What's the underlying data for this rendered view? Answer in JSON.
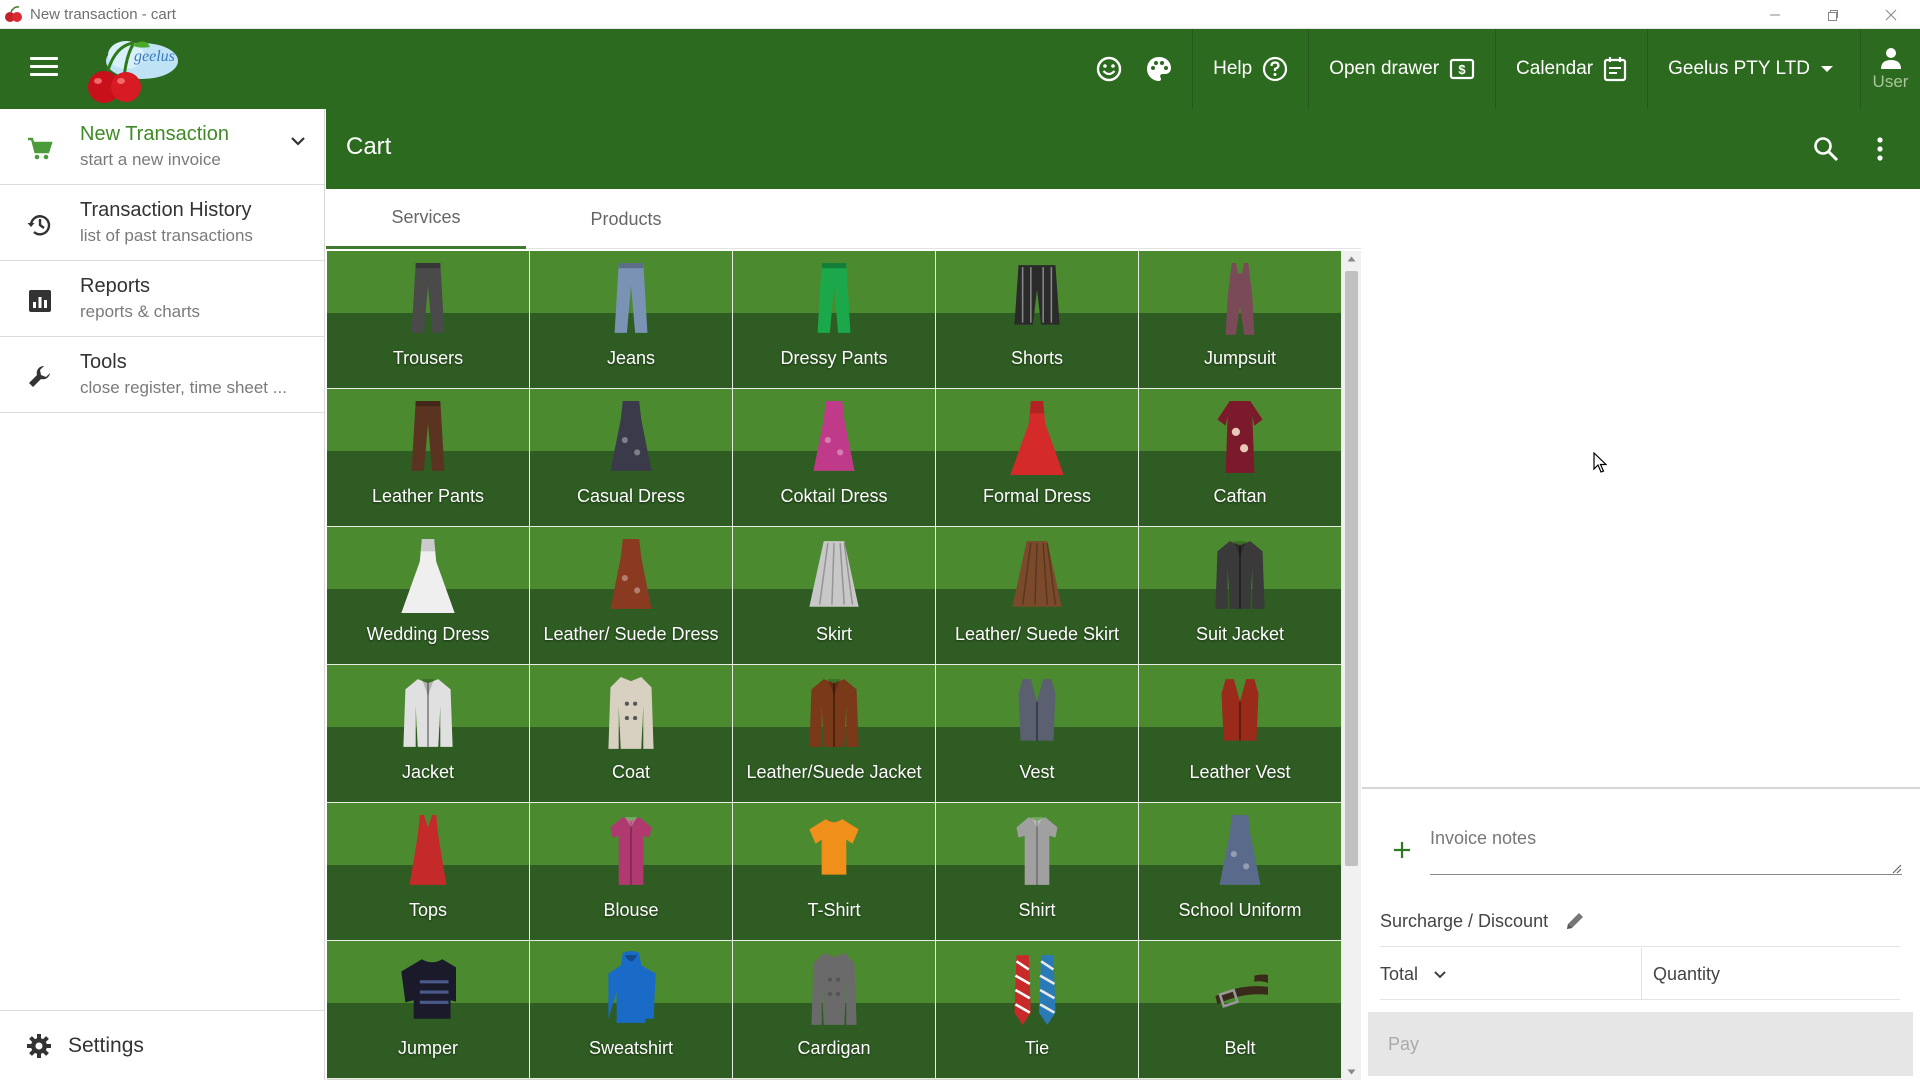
{
  "window": {
    "title": "New transaction - cart"
  },
  "topbar": {
    "help_label": "Help",
    "open_drawer_label": "Open drawer",
    "calendar_label": "Calendar",
    "company_label": "Geelus PTY LTD",
    "user_label": "User",
    "icons": [
      "menu-icon",
      "smiley-icon",
      "palette-icon",
      "help-circle-icon",
      "cash-drawer-icon",
      "calendar-icon",
      "dropdown-arrow-icon",
      "user-icon"
    ]
  },
  "sidebar": {
    "items": [
      {
        "title": "New Transaction",
        "subtitle": "start a new invoice",
        "icon": "cart-icon",
        "active": true
      },
      {
        "title": "Transaction History",
        "subtitle": "list of past transactions",
        "icon": "history-icon"
      },
      {
        "title": "Reports",
        "subtitle": "reports & charts",
        "icon": "reports-icon"
      },
      {
        "title": "Tools",
        "subtitle": "close register, time sheet ...",
        "icon": "wrench-icon"
      }
    ],
    "settings_label": "Settings"
  },
  "cart": {
    "title": "Cart",
    "tabs": [
      {
        "label": "Services",
        "active": true
      },
      {
        "label": "Products",
        "active": false
      }
    ],
    "tiles": [
      {
        "label": "Trousers",
        "art": "trousers",
        "color": "#4a4a4a"
      },
      {
        "label": "Jeans",
        "art": "trousers",
        "color": "#7a92b4"
      },
      {
        "label": "Dressy Pants",
        "art": "trousers",
        "color": "#1aa84a"
      },
      {
        "label": "Shorts",
        "art": "shorts",
        "color": "#2a2a2a"
      },
      {
        "label": "Jumpsuit",
        "art": "jumpsuit",
        "color": "#7a4a58"
      },
      {
        "label": "Leather Pants",
        "art": "trousers",
        "color": "#5a3420"
      },
      {
        "label": "Casual Dress",
        "art": "dress",
        "color": "#3a3a4a"
      },
      {
        "label": "Coktail Dress",
        "art": "dress",
        "color": "#c03a8a"
      },
      {
        "label": "Formal Dress",
        "art": "gown",
        "color": "#d42a2a"
      },
      {
        "label": "Caftan",
        "art": "caftan",
        "color": "#7a1a2a"
      },
      {
        "label": "Wedding Dress",
        "art": "gown",
        "color": "#efefef"
      },
      {
        "label": "Leather/ Suede Dress",
        "art": "dress",
        "color": "#8a3a20"
      },
      {
        "label": "Skirt",
        "art": "skirt",
        "color": "#c8c8c8"
      },
      {
        "label": "Leather/ Suede Skirt",
        "art": "skirt",
        "color": "#7a4a2a"
      },
      {
        "label": "Suit Jacket",
        "art": "jacket",
        "color": "#3a3a3a"
      },
      {
        "label": "Jacket",
        "art": "jacket",
        "color": "#e0e0e0"
      },
      {
        "label": "Coat",
        "art": "coat",
        "color": "#d8d0c0"
      },
      {
        "label": "Leather/Suede Jacket",
        "art": "jacket",
        "color": "#7a3a1a"
      },
      {
        "label": "Vest",
        "art": "vest",
        "color": "#5a6070"
      },
      {
        "label": "Leather Vest",
        "art": "vest",
        "color": "#9a2a1a"
      },
      {
        "label": "Tops",
        "art": "top",
        "color": "#c42a2a"
      },
      {
        "label": "Blouse",
        "art": "shirt",
        "color": "#b03a70"
      },
      {
        "label": "T-Shirt",
        "art": "tshirt",
        "color": "#f0901a"
      },
      {
        "label": "Shirt",
        "art": "shirt",
        "color": "#a0a0a0"
      },
      {
        "label": "School Uniform",
        "art": "dress",
        "color": "#5a6a8a"
      },
      {
        "label": "Jumper",
        "art": "sweater",
        "color": "#1a1a2a"
      },
      {
        "label": "Sweatshirt",
        "art": "hoodie",
        "color": "#1a6ac8"
      },
      {
        "label": "Cardigan",
        "art": "coat",
        "color": "#6a6a6a"
      },
      {
        "label": "Tie",
        "art": "tie",
        "color": "#c82a2a"
      },
      {
        "label": "Belt",
        "art": "belt",
        "color": "#3a2a1a"
      }
    ]
  },
  "panel": {
    "invoice_notes_placeholder": "Invoice notes",
    "surcharge_label": "Surcharge / Discount",
    "total_label": "Total",
    "quantity_label": "Quantity",
    "pay_label": "Pay"
  },
  "colors": {
    "brand_green": "#2c6a1f",
    "tile_green": "#4c8a30",
    "active_nav": "#3f8a26"
  }
}
